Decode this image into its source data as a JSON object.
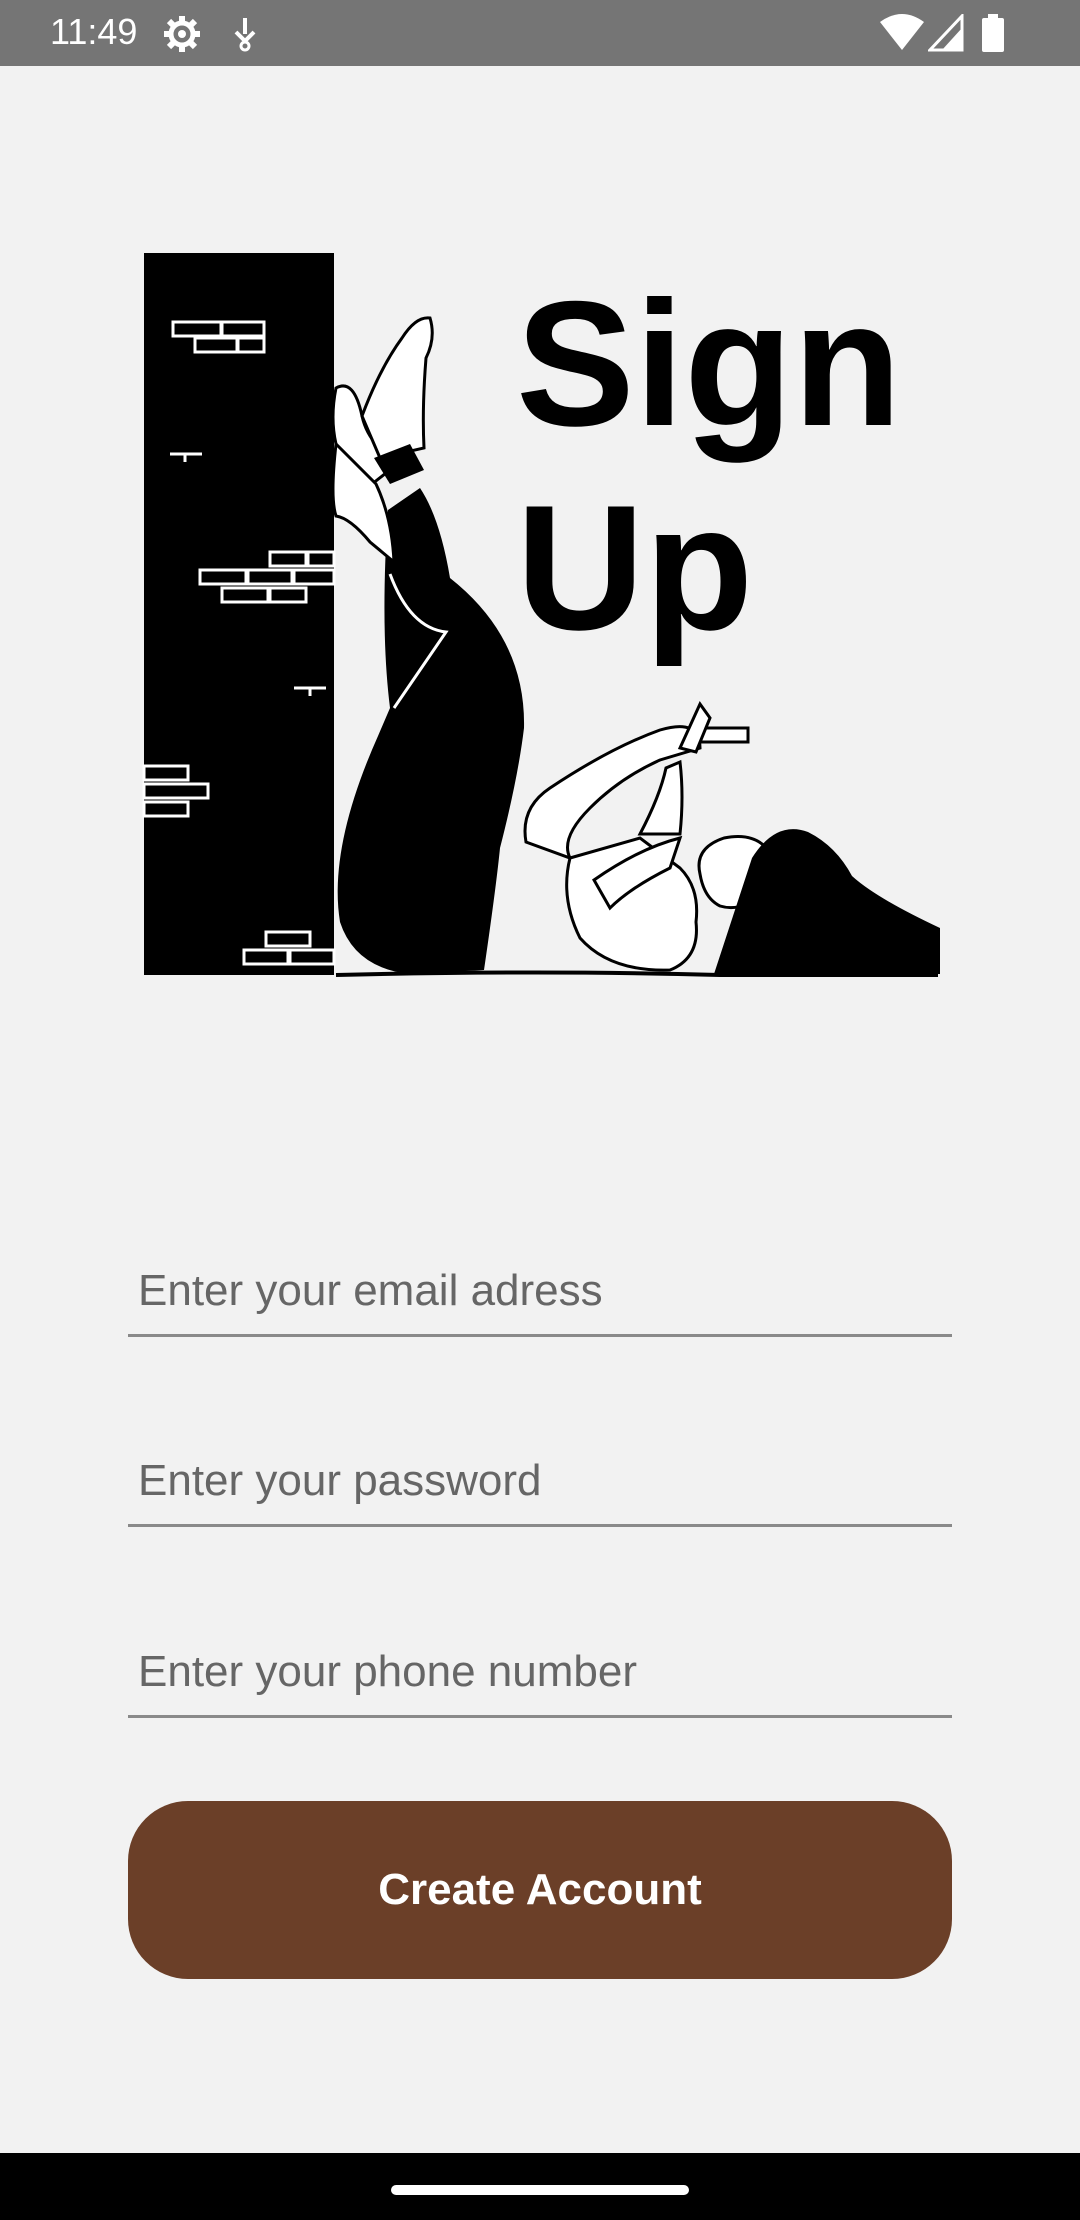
{
  "status_bar": {
    "time": "11:49",
    "left_icons": [
      "gear-icon",
      "download-icon"
    ],
    "right_icons": [
      "wifi-icon",
      "signal-icon",
      "battery-icon"
    ]
  },
  "hero": {
    "title": "Sign Up",
    "title_line1": "Sign",
    "title_line2": "Up"
  },
  "form": {
    "email": {
      "placeholder": "Enter your email adress",
      "value": ""
    },
    "password": {
      "placeholder": "Enter your password",
      "value": ""
    },
    "phone": {
      "placeholder": "Enter your phone number",
      "value": ""
    },
    "submit_label": "Create Account"
  },
  "colors": {
    "background": "#f2f2f2",
    "primary_button": "#6b3f28",
    "status_bar": "#757575",
    "nav_bar": "#000000"
  }
}
